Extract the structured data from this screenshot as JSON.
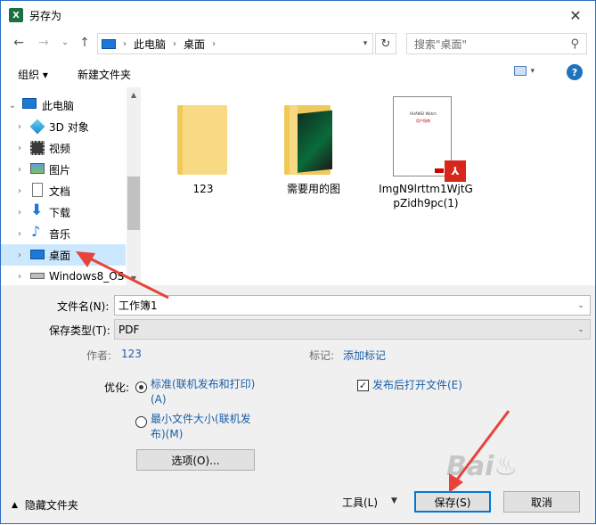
{
  "window": {
    "title": "另存为",
    "app_icon": "X"
  },
  "nav": {
    "breadcrumb": [
      "此电脑",
      "桌面"
    ],
    "search_placeholder": "搜索\"桌面\""
  },
  "toolbar": {
    "organize": "组织 ▾",
    "new_folder": "新建文件夹"
  },
  "tree": {
    "items": [
      {
        "label": "此电脑",
        "icon": "pc-icon"
      },
      {
        "label": "3D 对象",
        "icon": "3d-objects-icon"
      },
      {
        "label": "视频",
        "icon": "video-icon"
      },
      {
        "label": "图片",
        "icon": "pictures-icon"
      },
      {
        "label": "文档",
        "icon": "documents-icon"
      },
      {
        "label": "下载",
        "icon": "download-icon"
      },
      {
        "label": "音乐",
        "icon": "music-icon"
      },
      {
        "label": "桌面",
        "icon": "desktop-icon"
      },
      {
        "label": "Windows8_OS",
        "icon": "drive-icon"
      }
    ]
  },
  "files": [
    {
      "label": "123",
      "type": "folder"
    },
    {
      "label": "需要用的图",
      "type": "folder"
    },
    {
      "label": "ImgN9lrttm1WjtGpZidh9pc(1)",
      "type": "pdf",
      "thumb_title": "HUAWEI Watch",
      "thumb_sub": "用户指南"
    }
  ],
  "form": {
    "filename_label": "文件名(N):",
    "filename_value": "工作簿1",
    "filetype_label": "保存类型(T):",
    "filetype_value": "PDF",
    "author_label": "作者:",
    "author_value": "123",
    "tags_label": "标记:",
    "tags_value": "添加标记",
    "optimize_label": "优化:",
    "opt_standard_1": "标准(联机发布和打印)",
    "opt_standard_2": "(A)",
    "opt_min_1": "最小文件大小(联机发",
    "opt_min_2": "布)(M)",
    "open_after": "发布后打开文件(E)",
    "options_button": "选项(O)..."
  },
  "footer": {
    "hide_folders": "隐藏文件夹",
    "tools": "工具(L)",
    "save": "保存(S)",
    "cancel": "取消"
  },
  "colors": {
    "accent": "#0078d7",
    "link": "#1a5ea8",
    "selection": "#cce8ff",
    "annotation": "#e8433a"
  }
}
